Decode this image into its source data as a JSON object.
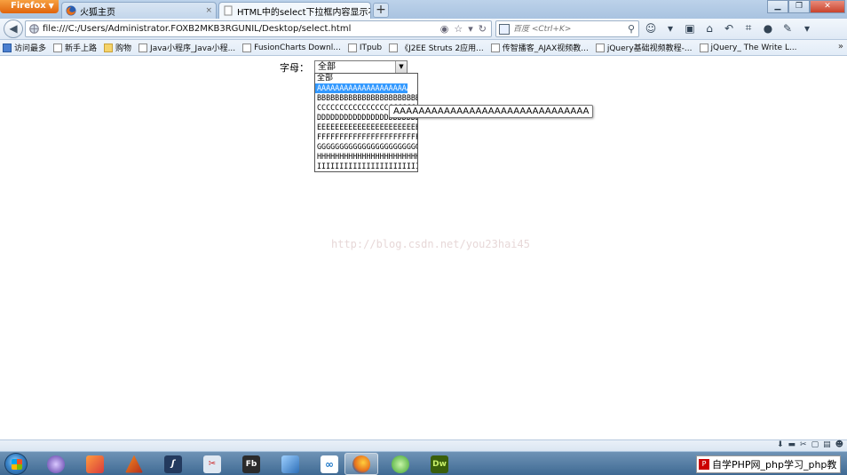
{
  "browser": {
    "menu_button": "Firefox",
    "tabs": [
      {
        "label": "火狐主页",
        "close": "×"
      },
      {
        "label": "HTML中的select下拉框内容显示不...",
        "close": "×"
      }
    ],
    "new_tab": "+"
  },
  "nav": {
    "url": "file:///C:/Users/Administrator.FOXB2MKB3RGUNIL/Desktop/select.html",
    "search_placeholder": "百度 <Ctrl+K>"
  },
  "bookmarks": [
    {
      "label": "访问最多",
      "icon": "star"
    },
    {
      "label": "新手上路",
      "icon": "page"
    },
    {
      "label": "购物",
      "icon": "folder"
    },
    {
      "label": "Java小程序_Java小程...",
      "icon": "page"
    },
    {
      "label": "FusionCharts Downl...",
      "icon": "page"
    },
    {
      "label": "ITpub",
      "icon": "page"
    },
    {
      "label": "《J2EE Struts 2应用...",
      "icon": "page"
    },
    {
      "label": "传智播客_AJAX视频教...",
      "icon": "page"
    },
    {
      "label": "jQuery基础视频教程-...",
      "icon": "page"
    },
    {
      "label": "jQuery_ The Write L...",
      "icon": "page"
    }
  ],
  "bookmarks_more": "»",
  "page": {
    "label": "字母：",
    "selected_value": "全部",
    "options": [
      "全部",
      "AAAAAAAAAAAAAAAAAAAAAAAAAAAAAAA",
      "BBBBBBBBBBBBBBBBBBBBBBBBBBBBBB",
      "CCCCCCCCCCCCCCCCCCCCCCCCCCCCCC",
      "DDDDDDDDDDDDDDDDDDDDDDDDDDDDDD",
      "EEEEEEEEEEEEEEEEEEEEEEEEEEEEEE",
      "FFFFFFFFFFFFFFFFFFFFFFFFFFFFFF",
      "GGGGGGGGGGGGGGGGGGGGGGGGGGGGGG",
      "HHHHHHHHHHHHHHHHHHHHHHHHHHHHHH",
      "IIIIIIIIIIIIIIIIIIIIIIIIIIIIII"
    ],
    "tooltip": "AAAAAAAAAAAAAAAAAAAAAAAAAAAAAAA",
    "watermark": "http://blog.csdn.net/you23hai45"
  },
  "taskbar": {
    "tray_text": "自学PHP网_php学习_php教"
  },
  "colors": {
    "selection": "#3399ff",
    "firefox_orange": "#e0640c"
  }
}
